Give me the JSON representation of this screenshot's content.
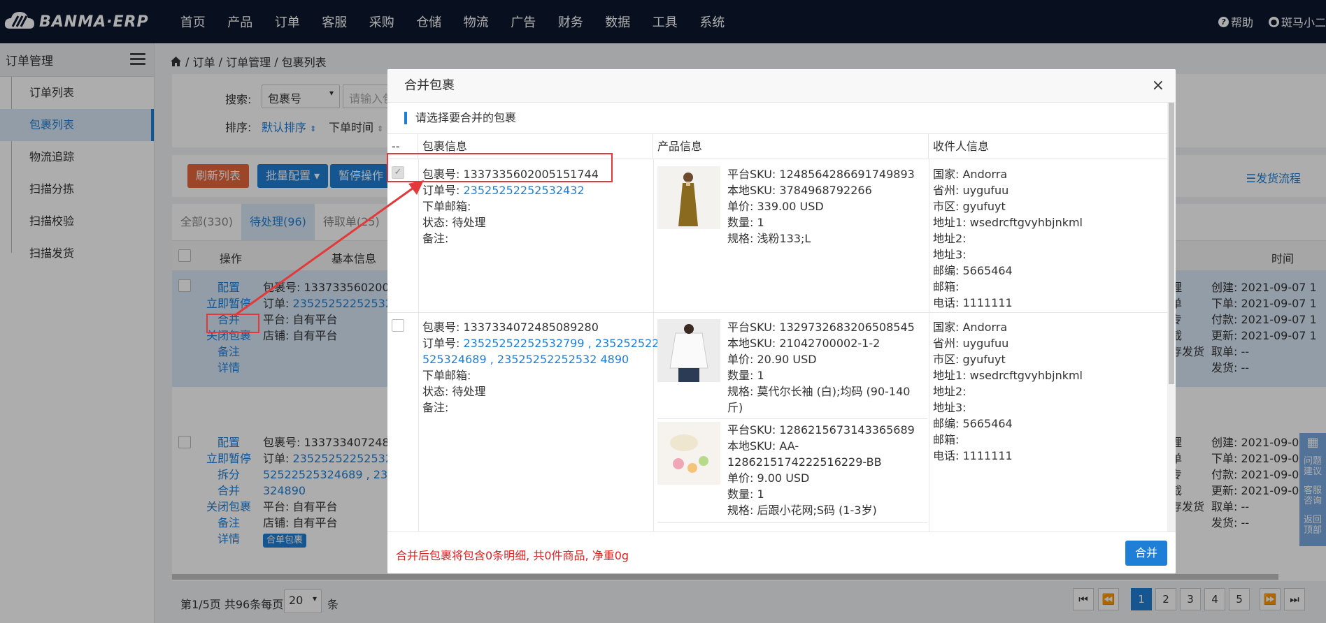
{
  "app": {
    "logo_text": "BANMA·ERP"
  },
  "nav": [
    "首页",
    "产品",
    "订单",
    "客服",
    "采购",
    "仓储",
    "物流",
    "广告",
    "财务",
    "数据",
    "工具",
    "系统"
  ],
  "top_right": {
    "help": "帮助",
    "user": "斑马小二"
  },
  "sidebar": {
    "title": "订单管理",
    "items": [
      "订单列表",
      "包裹列表",
      "物流追踪",
      "扫描分拣",
      "扫描校验",
      "扫描发货"
    ]
  },
  "breadcrumb": {
    "part1": "订单",
    "sep": "/",
    "part2": "订单管理",
    "part3": "包裹列表"
  },
  "filter": {
    "search_label": "搜索:",
    "search_type": "包裹号",
    "search_placeholder": "请输入包",
    "sort_label": "排序:",
    "sort_default": "默认排序",
    "sort_time": "下单时间"
  },
  "toolbar": {
    "refresh": "刷新列表",
    "batch_config": "批量配置",
    "pause": "暂停操作",
    "ship_flow": "发货流程"
  },
  "tabs": [
    "全部(330)",
    "待处理(96)",
    "待取单(25)"
  ],
  "table_header": {
    "ops": "操作",
    "basic": "基本信息",
    "time": "时间"
  },
  "rows": [
    {
      "ops": [
        "配置",
        "立即暂停",
        "合并",
        "关闭包裹",
        "备注",
        "详情"
      ],
      "package": "包裹号: 1337335602005",
      "order_label": "订单: ",
      "order": "23525252252532",
      "platform": "平台: 自有平台",
      "store": "店铺: 自有平台",
      "mid": [
        "理",
        "单",
        "专",
        "截",
        "存发货"
      ],
      "times": [
        "创建: 2021-09-07 1",
        "下单: 2021-09-07 1",
        "付款: 2021-09-07 1",
        "更新: 2021-09-07 1",
        "取单: --",
        "发货: --"
      ]
    },
    {
      "ops": [
        "配置",
        "立即暂停",
        "拆分",
        "合并",
        "关闭包裹",
        "备注",
        "详情"
      ],
      "package": "包裹号: 1337334072485",
      "order_label": "订单: ",
      "order": "23525252252532",
      "order2": "52522525324689",
      "order2_sep": " , 2352",
      "order3": "324890",
      "platform": "平台: 自有平台",
      "store": "店铺: 自有平台",
      "tag": "合单包裹",
      "mid": [
        "理",
        "单",
        "专",
        "截",
        "存发货"
      ],
      "times": [
        "创建: 2021-09-0",
        "下单: 2021-09-0",
        "付款: 2021-09-0",
        "更新: 2021-09-0",
        "取单: --",
        "发货: --"
      ]
    }
  ],
  "pager": {
    "info": "第1/5页 共96条每页",
    "per_page": "20",
    "unit": "条",
    "pages": [
      "1",
      "2",
      "3",
      "4",
      "5"
    ]
  },
  "float_bar": [
    "问题建议",
    "客服咨询",
    "返回顶部"
  ],
  "modal": {
    "title": "合并包裹",
    "close": "×",
    "subtitle": "请选择要合并的包裹",
    "headers": [
      "--",
      "包裹信息",
      "产品信息",
      "收件人信息"
    ],
    "packages": [
      {
        "package_no": "包裹号: 1337335602005151744",
        "order_label": "订单号: ",
        "orders": "23525252252532432",
        "email": "下单邮箱:",
        "status": "状态: 待处理",
        "note": "备注:",
        "products": [
          {
            "platform_sku": "平台SKU: 1248564286691749893",
            "local_sku": "本地SKU: 3784968792266",
            "price": "单价: 339.00 USD",
            "qty": "数量: 1",
            "spec": "规格: 浅粉133;L"
          }
        ],
        "recipient": [
          "国家: Andorra",
          "省州: uygufuu",
          "市区: gyufuyt",
          "地址1: wsedrcftgvyhbjnkml",
          "地址2:",
          "地址3:",
          "邮编: 5665464",
          "邮箱:",
          "电话: 1111111"
        ]
      },
      {
        "package_no": "包裹号: 1337334072485089280",
        "order_label": "订单号: ",
        "order_line1a": "23525252252532799",
        "order_line1b": " , 235252522",
        "order_line2a": "525324689",
        "order_line2b": " , ",
        "order_line2c": "23525252252532 4890",
        "email": "下单邮箱:",
        "status": "状态: 待处理",
        "note": "备注:",
        "products": [
          {
            "platform_sku": "平台SKU: 1329732683206508545",
            "local_sku": "本地SKU: 21042700002-1-2",
            "price": "单价: 20.90 USD",
            "qty": "数量: 1",
            "spec": "规格: 莫代尔长袖 (白);均码 (90-140",
            "spec2": "斤)"
          },
          {
            "platform_sku": "平台SKU: 1286215673143365689",
            "local_sku": "本地SKU: AA-",
            "local_sku2": "1286215174222516229-BB",
            "price": "单价: 9.00 USD",
            "qty": "数量: 1",
            "spec": "规格: 后跟小花网;S码 (1-3岁)"
          }
        ],
        "recipient": [
          "国家: Andorra",
          "省州: uygufuu",
          "市区: gyufuyt",
          "地址1: wsedrcftgvyhbjnkml",
          "地址2:",
          "地址3:",
          "邮编: 5665464",
          "邮箱:",
          "电话: 1111111"
        ]
      }
    ],
    "footer_text": "合并后包裹将包含0条明细, 共0件商品, 净重0g",
    "merge_button": "合并"
  },
  "colors": {
    "accent": "#1f7fd6",
    "topbar": "#0c1930",
    "annotation": "#e23a3a",
    "refresh": "#e8663d"
  }
}
